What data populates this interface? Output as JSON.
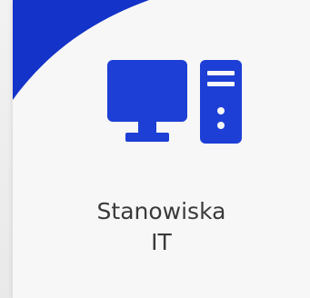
{
  "tile": {
    "label_line1": "Stanowiska",
    "label_line2": "IT",
    "icon": "computer-workstation-icon"
  },
  "colors": {
    "accent": "#1433c8",
    "icon": "#1d3fd6",
    "card_background": "#f7f7f7",
    "label_text": "#3a3a3a"
  }
}
